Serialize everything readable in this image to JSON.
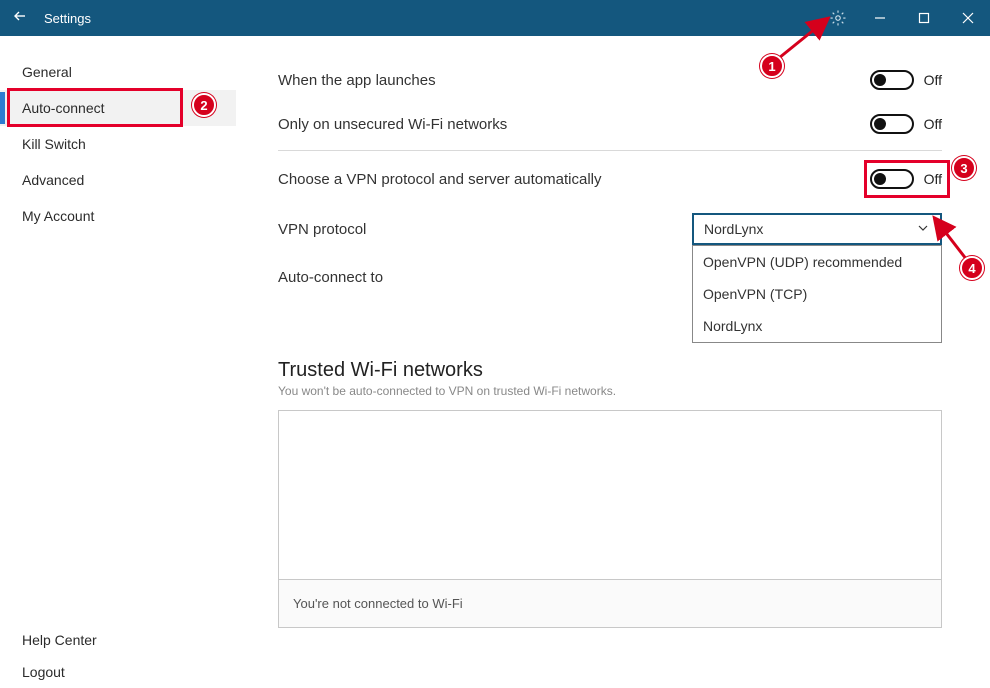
{
  "titlebar": {
    "title": "Settings"
  },
  "sidebar": {
    "items": [
      "General",
      "Auto-connect",
      "Kill Switch",
      "Advanced",
      "My Account"
    ],
    "bottom": [
      "Help Center",
      "Logout"
    ],
    "active_index": 1
  },
  "settings": {
    "row1_label": "When the app launches",
    "row1_state": "Off",
    "row2_label": "Only on unsecured Wi-Fi networks",
    "row2_state": "Off",
    "row3_label": "Choose a VPN protocol and server automatically",
    "row3_state": "Off",
    "row4_label": "VPN protocol",
    "row4_selected": "NordLynx",
    "row4_options": [
      "OpenVPN (UDP) recommended",
      "OpenVPN (TCP)",
      "NordLynx"
    ],
    "row5_label": "Auto-connect to"
  },
  "trusted": {
    "title": "Trusted Wi-Fi networks",
    "subtitle": "You won't be auto-connected to VPN on trusted Wi-Fi networks.",
    "not_connected": "You're not connected to Wi-Fi"
  },
  "annotations": {
    "b1": "1",
    "b2": "2",
    "b3": "3",
    "b4": "4"
  }
}
